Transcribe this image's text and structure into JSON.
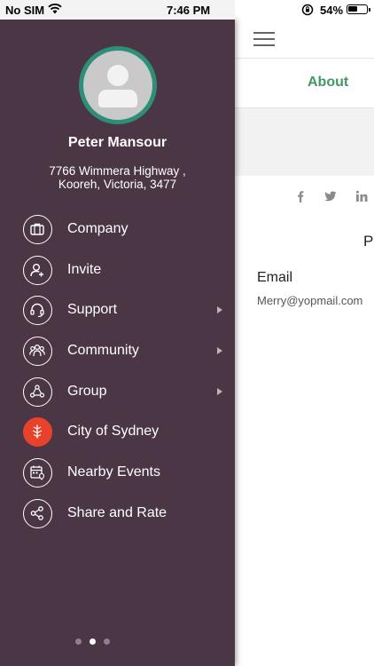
{
  "status_bar": {
    "carrier": "No SIM",
    "time": "7:46 PM",
    "battery_percent": "54%",
    "battery_level": 0.54
  },
  "drawer": {
    "user": {
      "name": "Peter Mansour",
      "address_line1": "7766 Wimmera Highway ,",
      "address_line2": "Kooreh, Victoria, 3477"
    },
    "menu": [
      {
        "label": "Company",
        "icon": "briefcase-icon",
        "has_submenu": false
      },
      {
        "label": "Invite",
        "icon": "add-user-icon",
        "has_submenu": false
      },
      {
        "label": "Support",
        "icon": "headset-icon",
        "has_submenu": true
      },
      {
        "label": "Community",
        "icon": "people-icon",
        "has_submenu": true
      },
      {
        "label": "Group",
        "icon": "group-icon",
        "has_submenu": true
      },
      {
        "label": "City of Sydney",
        "icon": "city-of-sydney-logo-icon",
        "has_submenu": false
      },
      {
        "label": "Nearby Events",
        "icon": "calendar-location-icon",
        "has_submenu": false
      },
      {
        "label": "Share and Rate",
        "icon": "share-icon",
        "has_submenu": false
      }
    ],
    "page_indicator": {
      "count": 3,
      "active_index": 1
    }
  },
  "background_page": {
    "tab_label": "About",
    "social_icons": [
      "facebook-icon",
      "twitter-icon",
      "linkedin-icon"
    ],
    "partial_heading": "P",
    "email_label": "Email",
    "email_value": "Merry@yopmail.com"
  },
  "colors": {
    "drawer_bg": "#4b3646",
    "avatar_ring": "#2e8f78",
    "accent_green": "#3f9a62",
    "city_icon_red": "#e8422b"
  }
}
